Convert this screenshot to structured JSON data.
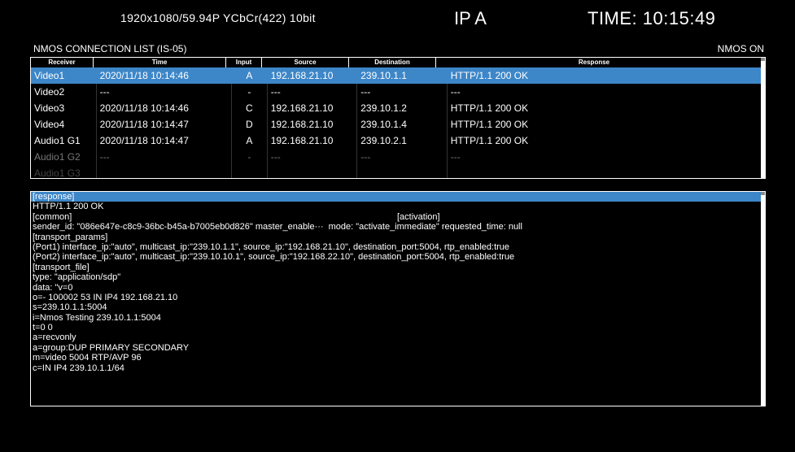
{
  "header": {
    "format": "1920x1080/59.94P YCbCr(422) 10bit",
    "ip": "IP A",
    "time": "TIME: 10:15:49"
  },
  "list_title": "NMOS CONNECTION LIST (IS-05)",
  "nmos_status": "NMOS ON",
  "table": {
    "headers": [
      "Receiver",
      "Time",
      "Input",
      "Source",
      "Destination",
      "Response"
    ],
    "rows": [
      {
        "receiver": "Video1",
        "time": "2020/11/18 10:14:46",
        "input": "A",
        "source": "192.168.21.10",
        "destination": "239.10.1.1",
        "response": "HTTP/1.1 200 OK"
      },
      {
        "receiver": "Video2",
        "time": "---",
        "input": "-",
        "source": "---",
        "destination": "---",
        "response": "---"
      },
      {
        "receiver": "Video3",
        "time": "2020/11/18 10:14:46",
        "input": "C",
        "source": "192.168.21.10",
        "destination": "239.10.1.2",
        "response": "HTTP/1.1 200 OK"
      },
      {
        "receiver": "Video4",
        "time": "2020/11/18 10:14:47",
        "input": "D",
        "source": "192.168.21.10",
        "destination": "239.10.1.4",
        "response": "HTTP/1.1 200 OK"
      },
      {
        "receiver": "Audio1 G1",
        "time": "2020/11/18 10:14:47",
        "input": "A",
        "source": "192.168.21.10",
        "destination": "239.10.2.1",
        "response": "HTTP/1.1 200 OK"
      },
      {
        "receiver": "Audio1 G2",
        "time": "---",
        "input": "-",
        "source": "---",
        "destination": "---",
        "response": "---"
      },
      {
        "receiver": "Audio1 G3",
        "time": "",
        "input": "",
        "source": "",
        "destination": "",
        "response": ""
      }
    ]
  },
  "response": {
    "lines": [
      "[response]",
      "HTTP/1.1 200 OK",
      "[common]",
      "sender_id: \"086e647e-c8c9-36bc-b45a-b7005eb0d826\"   master_enable···",
      "[transport_params]",
      "(Port1) interface_ip:\"auto\", multicast_ip:\"239.10.1.1\", source_ip:\"192.168.21.10\", destination_port:5004, rtp_enabled:true",
      "(Port2) interface_ip:\"auto\", multicast_ip:\"239.10.10.1\", source_ip:\"192.168.22.10\", destination_port:5004, rtp_enabled:true",
      "[transport_file]",
      "type: \"application/sdp\"",
      "data: \"v=0",
      "o=- 100002 53 IN IP4 192.168.21.10",
      "s=239.10.1.1:5004",
      "i=Nmos Testing 239.10.1.1:5004",
      "t=0 0",
      "a=recvonly",
      "a=group:DUP PRIMARY SECONDARY",
      "m=video 5004 RTP/AVP 96",
      "c=IN IP4 239.10.1.1/64"
    ],
    "activation_header": "[activation]",
    "activation_line": "mode: \"activate_immediate\"  requested_time: null"
  },
  "colors": {
    "selected": "#3d86c8",
    "background": "#000000",
    "text": "#ffffff"
  }
}
